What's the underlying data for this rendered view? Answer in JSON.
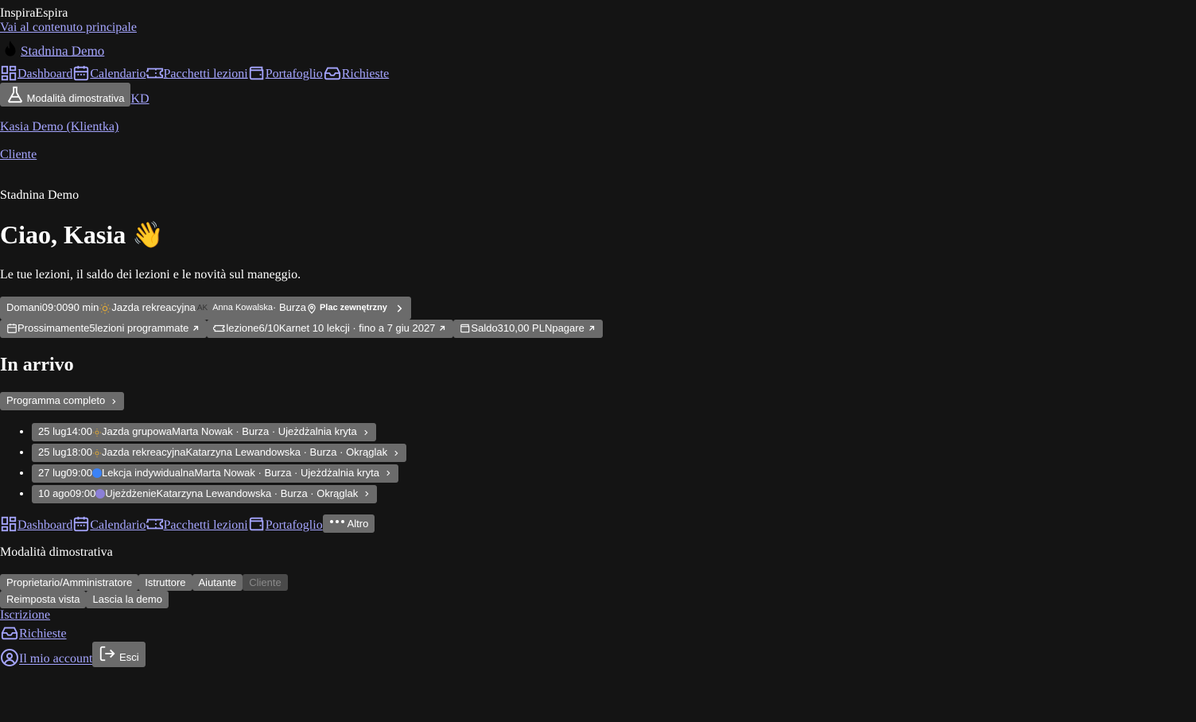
{
  "brand": "InspiraEspira",
  "skip_link": "Vai al contenuto principale",
  "stable_name": "Stadnina Demo",
  "top_nav": [
    "Dashboard",
    "Calendario",
    "Pacchetti lezioni",
    "Portafoglio",
    "Richieste"
  ],
  "demo_mode_label": "Modalità dimostrativa",
  "avatar_initials": "KD",
  "user_name": "Kasia Demo (Klientka)",
  "user_role": "Cliente",
  "stable_heading": "Stadnina Demo",
  "greeting": "Ciao, Kasia 👋",
  "subtitle": "Le tue lezioni, il saldo dei lezioni e le novità sul maneggio.",
  "next_lesson": {
    "when": "Domani",
    "time": "09:00",
    "duration": "90 min",
    "title": "Jazda rekreacyjna",
    "instructor_initials": "AK",
    "instructor": "Anna Kowalska",
    "horse": "· Burza",
    "place": "Plac zewnętrzny"
  },
  "stats": [
    {
      "label": "Prossimamente",
      "value": "5",
      "suffix": "lezioni programmate"
    },
    {
      "label": "lezione",
      "value": "6/10",
      "suffix": "Karnet 10 lekcji · fino a 7 giu 2027"
    },
    {
      "label": "Saldo",
      "value": "310,00 PLN",
      "suffix": "pagare"
    }
  ],
  "upcoming_heading": "In arrivo",
  "full_schedule_label": "Programma completo",
  "upcoming": [
    {
      "date": "25 lug",
      "time": "14:00",
      "color": "#d9a43a",
      "title": "Jazda grupowa",
      "details": "Marta Nowak · Burza · Ujeżdżalnia kryta"
    },
    {
      "date": "25 lug",
      "time": "18:00",
      "color": "#d9a43a",
      "title": "Jazda rekreacyjna",
      "details": "Katarzyna Lewandowska · Burza · Okrąglak"
    },
    {
      "date": "27 lug",
      "time": "09:00",
      "color": "#3b82f6",
      "title": "Lekcja indywidualna",
      "details": "Marta Nowak · Burza · Ujeżdżalnia kryta"
    },
    {
      "date": "10 ago",
      "time": "09:00",
      "color": "#8b7fd6",
      "title": "Ujeżdżenie",
      "details": "Katarzyna Lewandowska · Burza · Okrąglak"
    }
  ],
  "bottom_nav": [
    "Dashboard",
    "Calendario",
    "Pacchetti lezioni",
    "Portafoglio"
  ],
  "more_label": "Altro",
  "demo_heading": "Modalità dimostrativa",
  "roles": [
    "Proprietario/Amministratore",
    "Istruttore",
    "Aiutante",
    "Cliente"
  ],
  "reset_view_label": "Reimposta vista",
  "leave_demo_label": "Lascia la demo",
  "signup_label": "Iscrizione",
  "requests_label": "Richieste",
  "account_label": "Il mio account",
  "logout_label": "Esci",
  "colors": {
    "background": "#141414",
    "link": "#a5a5ff",
    "button": "#6b6b6b"
  }
}
